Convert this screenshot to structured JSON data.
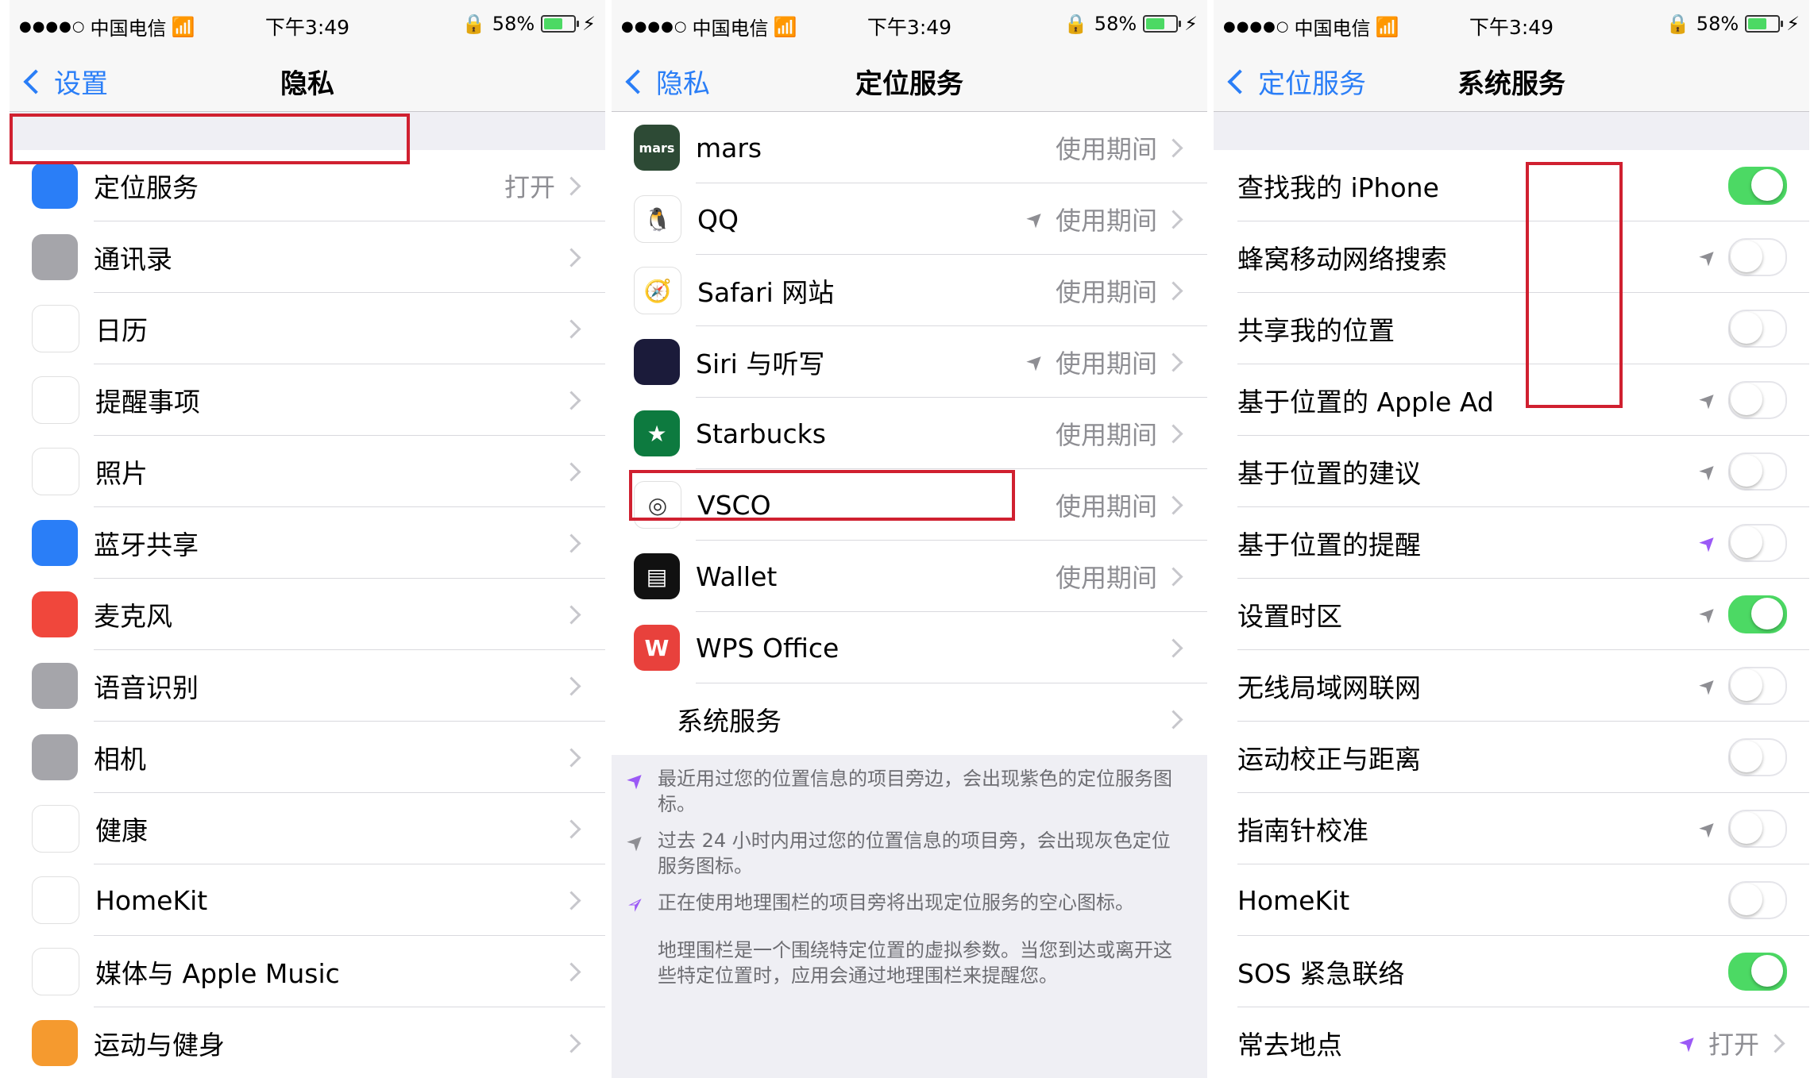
{
  "colors": {
    "accent": "#2a7ef7",
    "toggle_on": "#4cd964",
    "highlight_box": "#d02030",
    "purple_arrow": "#9b59f6",
    "gray_arrow": "#8e8e93"
  },
  "status": {
    "carrier": "中国电信",
    "time": "下午3:49",
    "battery": "58%",
    "battery_level": 0.58
  },
  "panel1": {
    "back": "设置",
    "title": "隐私",
    "rows": [
      {
        "icon": "location-icon",
        "color": "#2a7ef7",
        "label": "定位服务",
        "detail": "打开"
      },
      {
        "icon": "contacts-icon",
        "color": "#a5a5aa",
        "label": "通讯录",
        "detail": ""
      },
      {
        "icon": "calendar-icon",
        "color": "#ffffff",
        "label": "日历",
        "detail": ""
      },
      {
        "icon": "reminders-icon",
        "color": "#ffffff",
        "label": "提醒事项",
        "detail": ""
      },
      {
        "icon": "photos-icon",
        "color": "#ffffff",
        "label": "照片",
        "detail": ""
      },
      {
        "icon": "bluetooth-icon",
        "color": "#2a7ef7",
        "label": "蓝牙共享",
        "detail": ""
      },
      {
        "icon": "microphone-icon",
        "color": "#f0473c",
        "label": "麦克风",
        "detail": ""
      },
      {
        "icon": "speech-recognition-icon",
        "color": "#a5a5aa",
        "label": "语音识别",
        "detail": ""
      },
      {
        "icon": "camera-icon",
        "color": "#a5a5aa",
        "label": "相机",
        "detail": ""
      },
      {
        "icon": "health-icon",
        "color": "#ffffff",
        "label": "健康",
        "detail": ""
      },
      {
        "icon": "homekit-icon",
        "color": "#ffffff",
        "label": "HomeKit",
        "detail": ""
      },
      {
        "icon": "music-icon",
        "color": "#ffffff",
        "label": "媒体与 Apple Music",
        "detail": ""
      },
      {
        "icon": "motion-fitness-icon",
        "color": "#f59a2f",
        "label": "运动与健身",
        "detail": ""
      }
    ]
  },
  "panel2": {
    "back": "隐私",
    "title": "定位服务",
    "rows": [
      {
        "icon": "mars-icon",
        "color": "#2d4a35",
        "glyph": "mars",
        "label": "mars",
        "arrow": "",
        "detail": "使用期间"
      },
      {
        "icon": "qq-icon",
        "color": "#ffffff",
        "glyph": "🐧",
        "label": "QQ",
        "arrow": "gray",
        "detail": "使用期间"
      },
      {
        "icon": "safari-icon",
        "color": "#ffffff",
        "glyph": "🧭",
        "label": "Safari 网站",
        "arrow": "",
        "detail": "使用期间"
      },
      {
        "icon": "siri-icon",
        "color": "#1b1b3a",
        "glyph": "",
        "label": "Siri 与听写",
        "arrow": "gray",
        "detail": "使用期间"
      },
      {
        "icon": "starbucks-icon",
        "color": "#0d7a3f",
        "glyph": "★",
        "label": "Starbucks",
        "arrow": "",
        "detail": "使用期间"
      },
      {
        "icon": "vsco-icon",
        "color": "#ffffff",
        "glyph": "◎",
        "label": "VSCO",
        "arrow": "",
        "detail": "使用期间"
      },
      {
        "icon": "wallet-icon",
        "color": "#111111",
        "glyph": "▤",
        "label": "Wallet",
        "arrow": "",
        "detail": "使用期间"
      },
      {
        "icon": "wps-office-icon",
        "color": "#e8413c",
        "glyph": "W",
        "label": "WPS Office",
        "arrow": "",
        "detail": ""
      }
    ],
    "system_services": "系统服务",
    "notes": [
      {
        "arrow": "purple",
        "text": "最近用过您的位置信息的项目旁边，会出现紫色的定位服务图标。"
      },
      {
        "arrow": "gray",
        "text": "过去 24 小时内用过您的位置信息的项目旁，会出现灰色定位服务图标。"
      },
      {
        "arrow": "outline",
        "text": "正在使用地理围栏的项目旁将出现定位服务的空心图标。"
      }
    ],
    "geofence_note": "地理围栏是一个围绕特定位置的虚拟参数。当您到达或离开这些特定位置时，应用会通过地理围栏来提醒您。"
  },
  "panel3": {
    "back": "定位服务",
    "title": "系统服务",
    "rows": [
      {
        "label": "查找我的 iPhone",
        "arrow": "",
        "on": true
      },
      {
        "label": "蜂窝移动网络搜索",
        "arrow": "gray",
        "on": false
      },
      {
        "label": "共享我的位置",
        "arrow": "",
        "on": false
      },
      {
        "label": "基于位置的 Apple Ad",
        "arrow": "gray",
        "on": false
      },
      {
        "label": "基于位置的建议",
        "arrow": "gray",
        "on": false
      },
      {
        "label": "基于位置的提醒",
        "arrow": "purple",
        "on": false
      },
      {
        "label": "设置时区",
        "arrow": "gray",
        "on": true
      },
      {
        "label": "无线局域网联网",
        "arrow": "gray",
        "on": false
      },
      {
        "label": "运动校正与距离",
        "arrow": "",
        "on": false
      },
      {
        "label": "指南针校准",
        "arrow": "gray",
        "on": false
      },
      {
        "label": "HomeKit",
        "arrow": "",
        "on": false
      },
      {
        "label": "SOS 紧急联络",
        "arrow": "",
        "on": true
      },
      {
        "label": "常去地点",
        "arrow": "purple",
        "detail": "打开"
      }
    ]
  }
}
